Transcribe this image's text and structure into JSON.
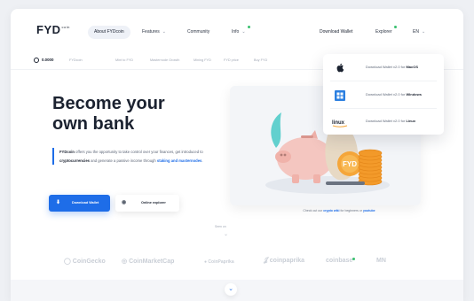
{
  "brand": {
    "logo": "FYD",
    "logo_sup": "coin",
    "accent": "#1e6de8",
    "green": "#39c06f"
  },
  "nav": {
    "items": [
      {
        "label": "About FYDcoin",
        "active": true
      },
      {
        "label": "Features",
        "chevron": true
      },
      {
        "label": "Community"
      },
      {
        "label": "Info",
        "chevron": true,
        "dot": true
      }
    ],
    "download_wallet": "Download Wallet",
    "explorer": "Explorer",
    "lang": "EN"
  },
  "ticker": {
    "price": "0.0000",
    "items": [
      "FYDcoin",
      "Mint to FYD",
      "Masternode Growth",
      "Mining FYD",
      "FYD price",
      "Buy FYD"
    ]
  },
  "hero": {
    "title_line1": "Become your",
    "title_line2": "own bank",
    "desc_lead": "FYDcoin",
    "desc_1": " offers you the opportunity to take control over your finances, get introduced to ",
    "desc_bold": "cryptocurrencies",
    "desc_2": " and  generate a passive income through ",
    "desc_link": "staking and masternodes",
    "desc_end": ".",
    "download_button": "Download Wallet",
    "explorer_button": "Online explorer"
  },
  "illustration": {
    "caption_1": "Check out our ",
    "caption_link": "crypto wiki",
    "caption_2": " for beginners or ",
    "caption_link2": "youtube",
    "coin_text": "FYD"
  },
  "seeus": "Seen on",
  "partners": [
    {
      "label": "CoinGecko"
    },
    {
      "label": "CoinMarketCap"
    },
    {
      "label": "CoinPaprika"
    },
    {
      "label": "coinpaprika"
    },
    {
      "label": "coinbase",
      "dot": true
    },
    {
      "label": "MN"
    }
  ],
  "dropdown": {
    "items": [
      {
        "icon": "apple-icon",
        "prefix": "Download Wallet v2.0 for ",
        "os": "MacOS"
      },
      {
        "icon": "windows-icon",
        "prefix": "Download Wallet v2.0 for ",
        "os": "Windows"
      },
      {
        "icon": "linux-icon",
        "prefix": "Download Wallet v2.0 for ",
        "os": "Linux"
      }
    ]
  }
}
